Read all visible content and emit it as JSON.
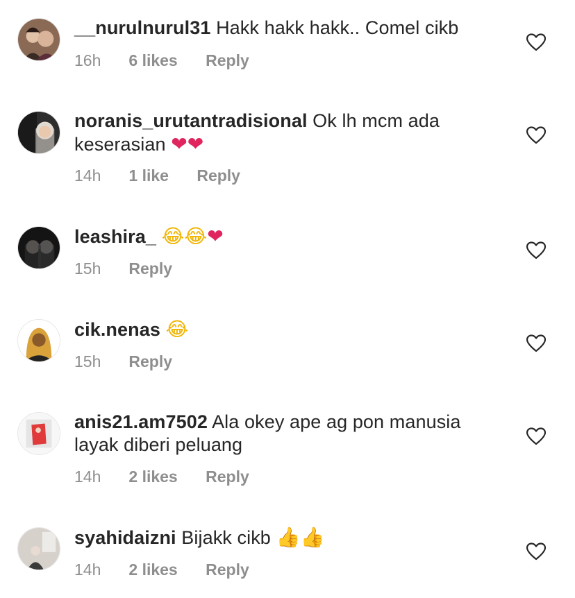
{
  "comments": [
    {
      "username": "__nurulnurul31",
      "text": "Hakk hakk hakk.. Comel cikb",
      "emojis": [],
      "time": "16h",
      "likes": "6 likes",
      "reply": "Reply",
      "avatar_colors": [
        "#6b4e3d",
        "#d9b9a0",
        "#3a2a24"
      ]
    },
    {
      "username": "noranis_urutantradisional",
      "text": "Ok lh mcm ada keserasian",
      "emojis": [
        "❤",
        "❤"
      ],
      "time": "14h",
      "likes": "1 like",
      "reply": "Reply",
      "avatar_colors": [
        "#2b2b2b",
        "#e8e4df",
        "#8a8a8a"
      ]
    },
    {
      "username": "leashira_",
      "text": "",
      "emojis": [
        "😂",
        "😂",
        "❤"
      ],
      "time": "15h",
      "likes": "",
      "reply": "Reply",
      "avatar_colors": [
        "#111111",
        "#b9b0a8",
        "#3d3d3d"
      ]
    },
    {
      "username": "cik.nenas",
      "text": "",
      "emojis": [
        "😂"
      ],
      "time": "15h",
      "likes": "",
      "reply": "Reply",
      "avatar_colors": [
        "#ffffff",
        "#d9a23a",
        "#8b5a2b"
      ]
    },
    {
      "username": "anis21.am7502",
      "text": "Ala okey ape ag pon manusia layak diberi peluang",
      "emojis": [],
      "time": "14h",
      "likes": "2 likes",
      "reply": "Reply",
      "avatar_colors": [
        "#f5f5f5",
        "#e03a3a",
        "#d8d8d8"
      ]
    },
    {
      "username": "syahidaizni",
      "text": "Bijakk cikb",
      "emojis": [
        "👍",
        "👍"
      ],
      "time": "14h",
      "likes": "2 likes",
      "reply": "Reply",
      "avatar_colors": [
        "#cfcac4",
        "#3a3a3a",
        "#eeeeee"
      ]
    }
  ],
  "colors": {
    "text": "#262626",
    "meta": "#8e8e8e",
    "heart_emoji": "#e0245e",
    "icon_stroke": "#262626"
  }
}
